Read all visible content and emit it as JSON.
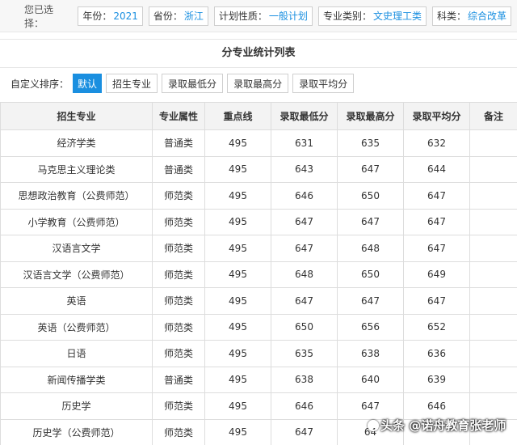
{
  "filters": {
    "label": "您已选择：",
    "items": [
      {
        "key": "年份：",
        "value": "2021"
      },
      {
        "key": "省份：",
        "value": "浙江"
      },
      {
        "key": "计划性质：",
        "value": "一般计划"
      },
      {
        "key": "专业类别：",
        "value": "文史理工类"
      },
      {
        "key": "科类：",
        "value": "综合改革"
      }
    ]
  },
  "title": "分专业统计列表",
  "sort": {
    "label": "自定义排序：",
    "buttons": [
      "默认",
      "招生专业",
      "录取最低分",
      "录取最高分",
      "录取平均分"
    ],
    "active_index": 0
  },
  "table": {
    "headers": [
      "招生专业",
      "专业属性",
      "重点线",
      "录取最低分",
      "录取最高分",
      "录取平均分",
      "备注"
    ],
    "rows": [
      [
        "经济学类",
        "普通类",
        "495",
        "631",
        "635",
        "632",
        ""
      ],
      [
        "马克思主义理论类",
        "普通类",
        "495",
        "643",
        "647",
        "644",
        ""
      ],
      [
        "思想政治教育（公费师范）",
        "师范类",
        "495",
        "646",
        "650",
        "647",
        ""
      ],
      [
        "小学教育（公费师范）",
        "师范类",
        "495",
        "647",
        "647",
        "647",
        ""
      ],
      [
        "汉语言文学",
        "师范类",
        "495",
        "647",
        "648",
        "647",
        ""
      ],
      [
        "汉语言文学（公费师范）",
        "师范类",
        "495",
        "648",
        "650",
        "649",
        ""
      ],
      [
        "英语",
        "师范类",
        "495",
        "647",
        "647",
        "647",
        ""
      ],
      [
        "英语（公费师范）",
        "师范类",
        "495",
        "650",
        "656",
        "652",
        ""
      ],
      [
        "日语",
        "师范类",
        "495",
        "635",
        "638",
        "636",
        ""
      ],
      [
        "新闻传播学类",
        "普通类",
        "495",
        "638",
        "640",
        "639",
        ""
      ],
      [
        "历史学",
        "师范类",
        "495",
        "646",
        "647",
        "646",
        ""
      ],
      [
        "历史学（公费师范）",
        "师范类",
        "495",
        "647",
        "64",
        "",
        ""
      ]
    ]
  },
  "watermark": "头条 @诺舟教育张老师",
  "colors": {
    "accent": "#1a8fe0",
    "header_bg": "#f3f3f3",
    "border": "#dddddd"
  }
}
